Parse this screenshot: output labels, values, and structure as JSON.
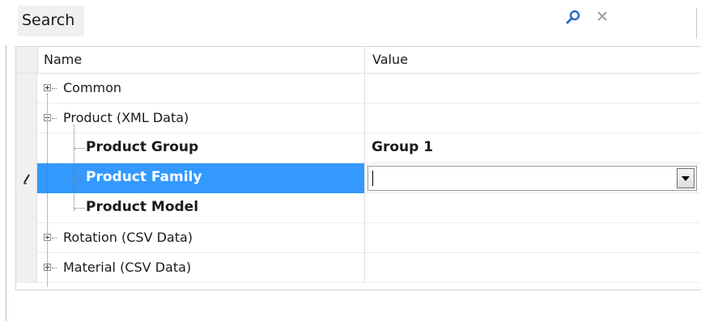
{
  "search": {
    "label": "Search",
    "placeholder": "",
    "value": ""
  },
  "grid": {
    "columns": {
      "name": "Name",
      "value": "Value"
    },
    "rows": [
      {
        "label": "Common",
        "kind": "category",
        "expanded": false,
        "value": ""
      },
      {
        "label": "Product (XML Data)",
        "kind": "category",
        "expanded": true,
        "value": ""
      },
      {
        "label": "Product Group",
        "kind": "property",
        "value": "Group 1"
      },
      {
        "label": "Product Family",
        "kind": "property",
        "value": "",
        "selected": true,
        "editing": true
      },
      {
        "label": "Product Model",
        "kind": "property",
        "value": ""
      },
      {
        "label": "Rotation (CSV Data)",
        "kind": "category",
        "expanded": false,
        "value": ""
      },
      {
        "label": "Material (CSV Data)",
        "kind": "category",
        "expanded": false,
        "value": ""
      }
    ]
  },
  "colors": {
    "selection": "#3399ff",
    "gutter": "#f0f0f0",
    "grid_line": "#e0e0e0",
    "search_icon": "#2b6cc4"
  },
  "icons": {
    "search": "search-icon",
    "close": "close-icon",
    "edit": "pencil-icon",
    "dropdown": "chevron-down-icon"
  }
}
